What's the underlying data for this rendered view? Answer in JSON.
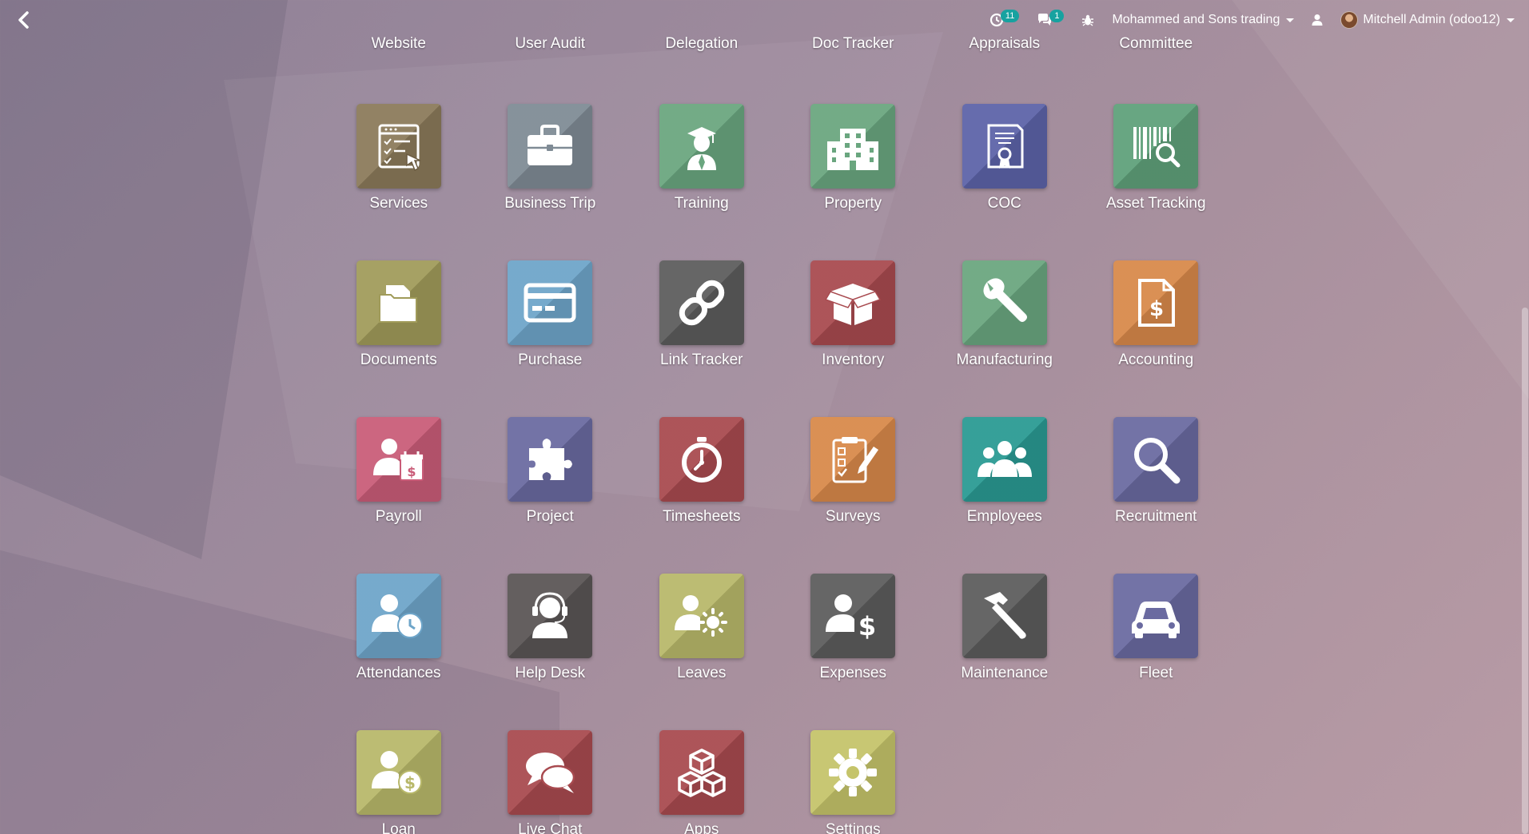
{
  "topbar": {
    "activity_count": "11",
    "messages_count": "1",
    "company": "Mohammed and Sons trading",
    "user": "Mitchell Admin (odoo12)"
  },
  "cut_off_apps": [
    "Website",
    "User Audit",
    "Delegation",
    "Doc Tracker",
    "Appraisals",
    "Committee"
  ],
  "apps": [
    {
      "label": "Services",
      "color": "#8b7a5a",
      "icon": "services-icon"
    },
    {
      "label": "Business Trip",
      "color": "#7f8b95",
      "icon": "briefcase-icon"
    },
    {
      "label": "Training",
      "color": "#6aa67f",
      "icon": "graduate-icon"
    },
    {
      "label": "Property",
      "color": "#6aa67f",
      "icon": "building-icon"
    },
    {
      "label": "COC",
      "color": "#5c63a8",
      "icon": "certificate-icon"
    },
    {
      "label": "Asset Tracking",
      "color": "#5fa07a",
      "icon": "barcode-search-icon"
    },
    {
      "label": "Documents",
      "color": "#a09b5a",
      "icon": "folder-icon"
    },
    {
      "label": "Purchase",
      "color": "#6ea5c9",
      "icon": "credit-card-icon"
    },
    {
      "label": "Link Tracker",
      "color": "#5c5c5c",
      "icon": "link-icon"
    },
    {
      "label": "Inventory",
      "color": "#a84a4f",
      "icon": "box-icon"
    },
    {
      "label": "Manufacturing",
      "color": "#6aa67f",
      "icon": "wrench-icon"
    },
    {
      "label": "Accounting",
      "color": "#d8894a",
      "icon": "invoice-icon"
    },
    {
      "label": "Payroll",
      "color": "#c95c78",
      "icon": "payroll-icon"
    },
    {
      "label": "Project",
      "color": "#6a6aa0",
      "icon": "puzzle-icon"
    },
    {
      "label": "Timesheets",
      "color": "#a84a4f",
      "icon": "stopwatch-icon"
    },
    {
      "label": "Surveys",
      "color": "#d8894a",
      "icon": "survey-icon"
    },
    {
      "label": "Employees",
      "color": "#2a9a93",
      "icon": "people-icon"
    },
    {
      "label": "Recruitment",
      "color": "#6a6aa0",
      "icon": "magnifier-icon"
    },
    {
      "label": "Attendances",
      "color": "#6ea5c9",
      "icon": "user-clock-icon"
    },
    {
      "label": "Help Desk",
      "color": "#5a5555",
      "icon": "headset-icon"
    },
    {
      "label": "Leaves",
      "color": "#b8b86a",
      "icon": "user-sun-icon"
    },
    {
      "label": "Expenses",
      "color": "#5c5c5c",
      "icon": "user-dollar-icon"
    },
    {
      "label": "Maintenance",
      "color": "#5c5c5c",
      "icon": "hammer-icon"
    },
    {
      "label": "Fleet",
      "color": "#6a6aa0",
      "icon": "car-icon"
    },
    {
      "label": "Loan",
      "color": "#b8b86a",
      "icon": "user-coin-icon"
    },
    {
      "label": "Live Chat",
      "color": "#a84a4f",
      "icon": "chat-icon"
    },
    {
      "label": "Apps",
      "color": "#a84a4f",
      "icon": "cubes-icon"
    },
    {
      "label": "Settings",
      "color": "#c5c46a",
      "icon": "gear-icon"
    }
  ]
}
